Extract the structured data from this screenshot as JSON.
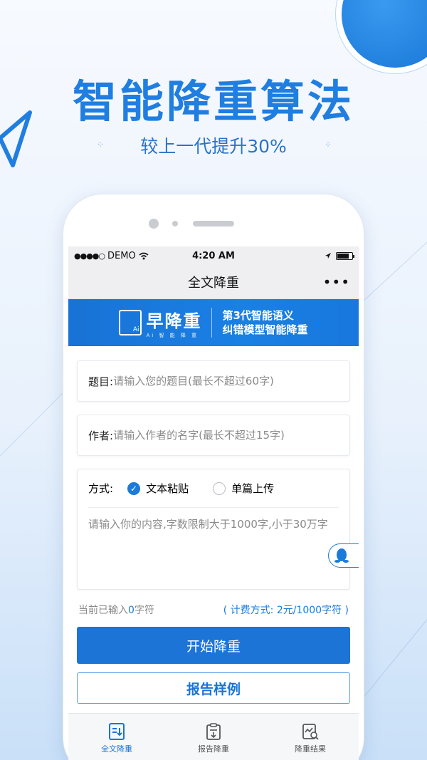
{
  "hero": {
    "title": "智能降重算法",
    "subtitle": "较上一代提升30%",
    "dot_glyph": "⁘"
  },
  "status_bar": {
    "carrier": "DEMO",
    "signal_dots": "●●●●○",
    "time": "4:20 AM"
  },
  "nav": {
    "title": "全文降重",
    "more_label": "•••"
  },
  "banner": {
    "logo_text": "早降重",
    "logo_sub": "Ai 智 能 降 重",
    "logo_ai": "Ai",
    "tagline_line1": "第3代智能语义",
    "tagline_line2": "纠错模型智能降重"
  },
  "form": {
    "title_label": "题目:",
    "title_placeholder": "请输入您的题目(最长不超过60字)",
    "author_label": "作者:",
    "author_placeholder": "请输入作者的名字(最长不超过15字)",
    "method_label": "方式:",
    "method_options": [
      "文本粘贴",
      "单篇上传"
    ],
    "method_selected": "文本粘贴",
    "content_placeholder": "请输入你的内容,字数限制大于1000字,小于30万字"
  },
  "counter": {
    "prefix": "当前已输入",
    "count": "0",
    "suffix": "字符",
    "fee": "( 计费方式: 2元/1000字符 )"
  },
  "buttons": {
    "start": "开始降重",
    "sample": "报告样例"
  },
  "tabs": [
    {
      "label": "全文降重",
      "icon": "document-edit-icon",
      "active": true
    },
    {
      "label": "报告降重",
      "icon": "clipboard-icon",
      "active": false
    },
    {
      "label": "降重结果",
      "icon": "report-search-icon",
      "active": false
    }
  ],
  "colors": {
    "accent": "#1b74d6",
    "hero_title": "#1f7ee0",
    "banner_bg": "#1a80e4"
  }
}
